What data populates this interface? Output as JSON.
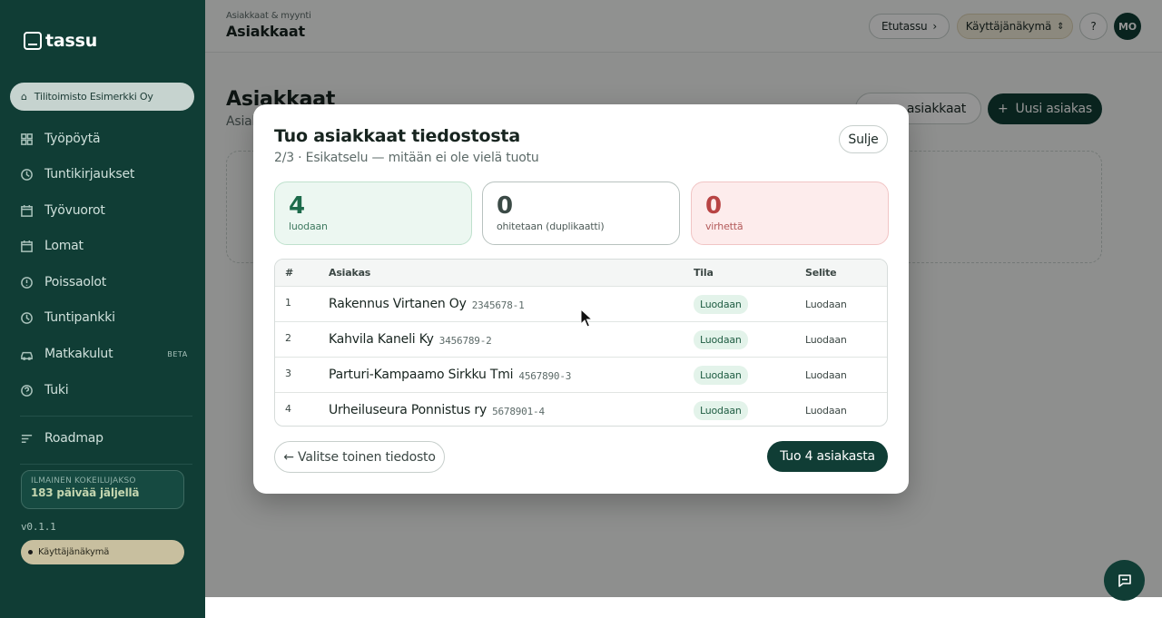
{
  "brand": {
    "name": "tassu"
  },
  "sidebar": {
    "organization": "Tilitoimisto Esimerkki Oy",
    "items": [
      {
        "label": "Työpöytä",
        "icon": "dashboard-icon"
      },
      {
        "label": "Tuntikirjaukset",
        "icon": "clock-icon"
      },
      {
        "label": "Työvuorot",
        "icon": "calendar-icon"
      },
      {
        "label": "Lomat",
        "icon": "calendar-icon"
      },
      {
        "label": "Poissaolot",
        "icon": "alert-circle-icon"
      },
      {
        "label": "Tuntipankki",
        "icon": "clock-icon"
      },
      {
        "label": "Matkakulut",
        "icon": "car-icon",
        "badge": "BETA"
      },
      {
        "label": "Tuki",
        "icon": "help-circle-icon"
      }
    ],
    "roadmap": "Roadmap",
    "trial": {
      "label": "ILMAINEN KOKEILUJAKSO",
      "days": "183 päivää jäljellä"
    },
    "version": "v0.1.1",
    "view": "Käyttäjänäkymä"
  },
  "header": {
    "breadcrumb": "Asiakkaat & myynti",
    "title": "Asiakkaat",
    "home_button": "Etutassu",
    "view_selector": "Käyttäjänäkymä",
    "help": "?",
    "avatar": "MO"
  },
  "page": {
    "title": "Asiakkaat",
    "subtitle": "Asiak",
    "import_button": "o asiakkaat",
    "new_button": "Uusi asiakas"
  },
  "modal": {
    "title": "Tuo asiakkaat tiedostosta",
    "subtitle": "2/3 · Esikatselu — mitään ei ole vielä tuotu",
    "close": "Sulje",
    "stats": {
      "create": {
        "value": "4",
        "label": "luodaan"
      },
      "skip": {
        "value": "0",
        "label": "ohitetaan (duplikaatti)"
      },
      "error": {
        "value": "0",
        "label": "virhettä"
      }
    },
    "table": {
      "headers": {
        "index": "#",
        "customer": "Asiakas",
        "status": "Tila",
        "note": "Selite"
      },
      "rows": [
        {
          "index": "1",
          "name": "Rakennus Virtanen Oy",
          "business_id": "2345678-1",
          "status": "Luodaan",
          "note": "Luodaan"
        },
        {
          "index": "2",
          "name": "Kahvila Kaneli Ky",
          "business_id": "3456789-2",
          "status": "Luodaan",
          "note": "Luodaan"
        },
        {
          "index": "3",
          "name": "Parturi-Kampaamo Sirkku Tmi",
          "business_id": "4567890-3",
          "status": "Luodaan",
          "note": "Luodaan"
        },
        {
          "index": "4",
          "name": "Urheiluseura Ponnistus ry",
          "business_id": "5678901-4",
          "status": "Luodaan",
          "note": "Luodaan"
        }
      ]
    },
    "back_button": "← Valitse toinen tiedosto",
    "import_button": "Tuo 4 asiakasta"
  },
  "colors": {
    "brand": "#103d35",
    "success_bg": "#ecf7f1",
    "error_bg": "#fdecec"
  }
}
